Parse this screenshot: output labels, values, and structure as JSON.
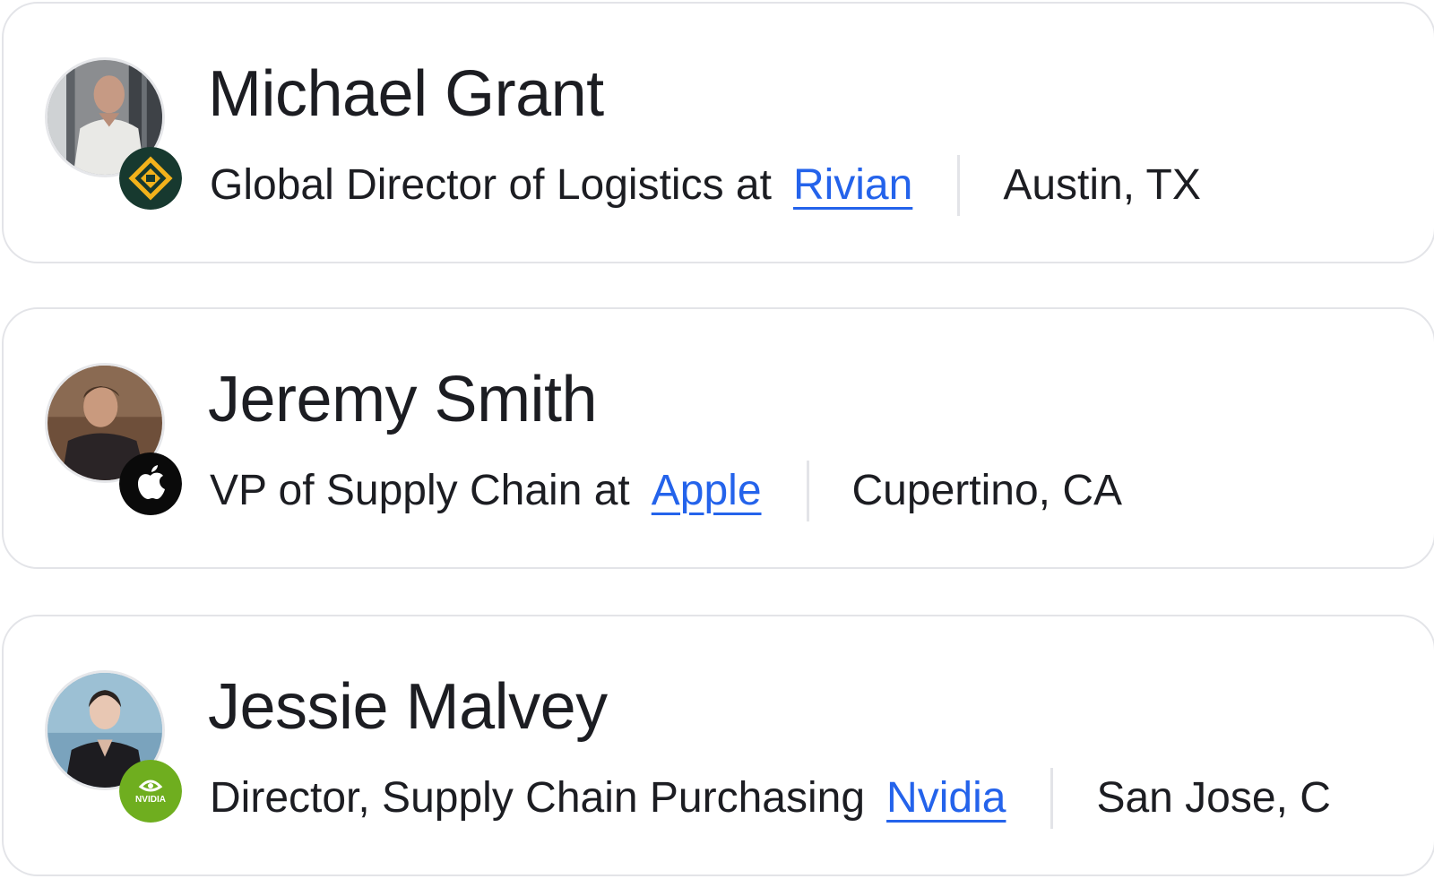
{
  "people": [
    {
      "name": "Michael Grant",
      "role": "Global Director of Logistics at",
      "company": "Rivian",
      "location": "Austin, TX",
      "logo_icon": "rivian-logo-icon",
      "logo_colors": {
        "background": "#17392f",
        "mark": "#f3b21b"
      }
    },
    {
      "name": "Jeremy Smith",
      "role": "VP of Supply Chain at",
      "company": "Apple",
      "location": "Cupertino, CA",
      "logo_icon": "apple-logo-icon",
      "logo_colors": {
        "background": "#0a0a0a",
        "mark": "#ffffff"
      }
    },
    {
      "name": "Jessie Malvey",
      "role": "Director, Supply Chain Purchasing",
      "company": "Nvidia",
      "location": "San Jose, C",
      "logo_icon": "nvidia-logo-icon",
      "logo_colors": {
        "background": "#6fae1f",
        "mark": "#ffffff"
      },
      "logo_text": "NVIDIA"
    }
  ],
  "colors": {
    "text": "#1c1d22",
    "link": "#2463eb",
    "border": "#e3e4e8",
    "background": "#ffffff"
  }
}
